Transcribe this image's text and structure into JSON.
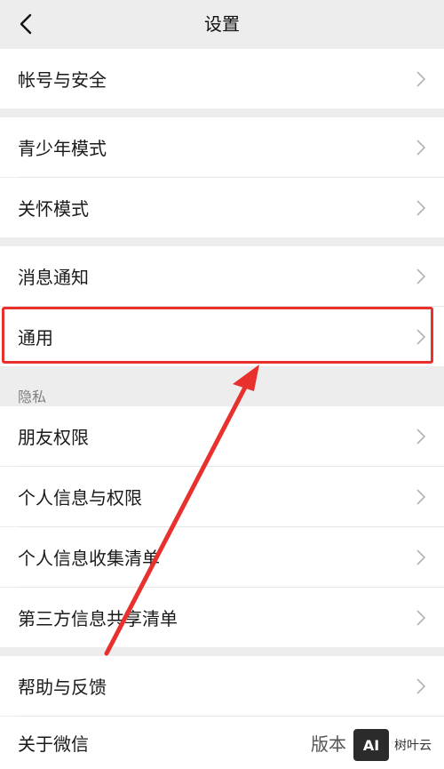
{
  "header": {
    "title": "设置"
  },
  "group1": [
    {
      "label": "帐号与安全"
    }
  ],
  "group2": [
    {
      "label": "青少年模式"
    },
    {
      "label": "关怀模式"
    }
  ],
  "group3": [
    {
      "label": "消息通知"
    },
    {
      "label": "通用"
    }
  ],
  "privacy": {
    "section_title": "隐私",
    "items": [
      {
        "label": "朋友权限"
      },
      {
        "label": "个人信息与权限"
      },
      {
        "label": "个人信息收集清单"
      },
      {
        "label": "第三方信息共享清单"
      }
    ]
  },
  "group5": [
    {
      "label": "帮助与反馈"
    },
    {
      "label": "关于微信",
      "value": "版本"
    }
  ],
  "watermark": {
    "badge": "AI",
    "text": "树叶云"
  },
  "colors": {
    "highlight": "#e8302d",
    "background": "#ededed"
  }
}
